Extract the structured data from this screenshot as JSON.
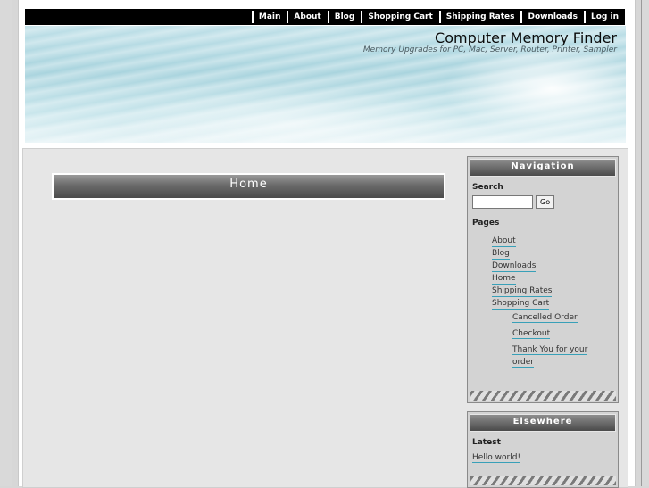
{
  "nav": {
    "items": [
      "Main",
      "About",
      "Blog",
      "Shopping Cart",
      "Shipping Rates",
      "Downloads",
      "Log in"
    ]
  },
  "site": {
    "title": "Computer Memory Finder",
    "tagline": "Memory Upgrades for PC, Mac, Server, Router, Printer, Sampler"
  },
  "main": {
    "page_title": "Home"
  },
  "sidebar": {
    "navigation": {
      "title": "Navigation",
      "search_label": "Search",
      "search_value": "",
      "go_label": "Go",
      "pages_label": "Pages",
      "pages": [
        "About",
        "Blog",
        "Downloads",
        "Home",
        "Shipping Rates",
        "Shopping Cart"
      ],
      "subpages": [
        "Cancelled Order",
        "Checkout",
        "Thank You for your order"
      ]
    },
    "elsewhere": {
      "title": "Elsewhere",
      "latest_label": "Latest",
      "latest_post": "Hello world!"
    }
  },
  "colors": {
    "link_underline": "#38a0b8",
    "nav_background": "#000000"
  }
}
